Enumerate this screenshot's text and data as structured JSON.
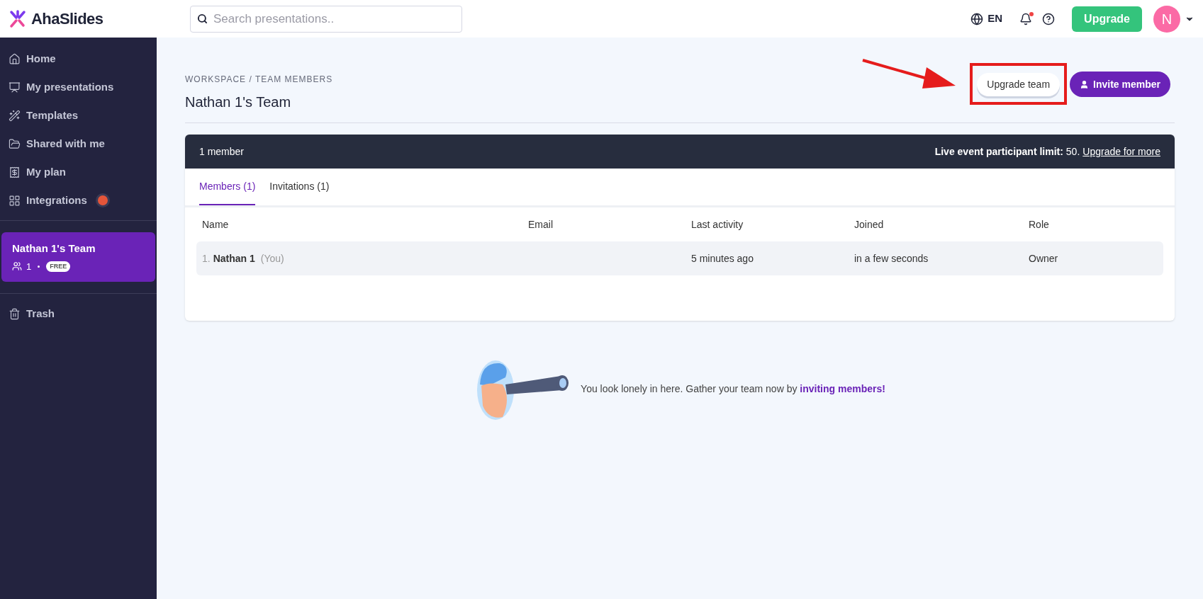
{
  "header": {
    "logo": "AhaSlides",
    "search": {
      "placeholder": "Search presentations.."
    },
    "language": "EN",
    "notification_dot": true,
    "upgrade_button": "Upgrade",
    "avatar": "N"
  },
  "sidebar": {
    "items": [
      {
        "label": "Home",
        "selected": false
      },
      {
        "label": "My presentations",
        "selected": false
      },
      {
        "label": "Templates",
        "selected": false
      },
      {
        "label": "Shared with me",
        "selected": false
      },
      {
        "label": "My plan",
        "selected": false
      },
      {
        "label": "Integrations",
        "selected": false
      }
    ],
    "team": {
      "name": "Nathan 1's Team",
      "members": "1",
      "plan": "FREE",
      "selected": true
    },
    "trash": "Trash"
  },
  "page": {
    "breadcrumb": "WORKSPACE / TEAM MEMBERS",
    "title": "Nathan 1's Team",
    "buttons": {
      "upgrade_team": "Upgrade team",
      "invite_member": "Invite member"
    }
  },
  "panel": {
    "member_count": "1 member",
    "limit_label": "Live event participant limit:",
    "limit_value": "50.",
    "limit_link": "Upgrade for more",
    "tabs": [
      {
        "label": "Members (1)",
        "selected": true
      },
      {
        "label": "Invitations (1)",
        "selected": false
      }
    ],
    "table": {
      "columns": [
        "Name",
        "Email",
        "Last activity",
        "Joined",
        "Role"
      ],
      "rows": [
        {
          "index": "1.",
          "name": "Nathan 1",
          "note": "(You)",
          "email": "",
          "last_activity": "5 minutes ago",
          "joined": "in a few seconds",
          "role": "Owner"
        }
      ]
    }
  },
  "empty_state": {
    "text": "You look lonely in here. Gather your team now by",
    "link": "inviting members!"
  }
}
